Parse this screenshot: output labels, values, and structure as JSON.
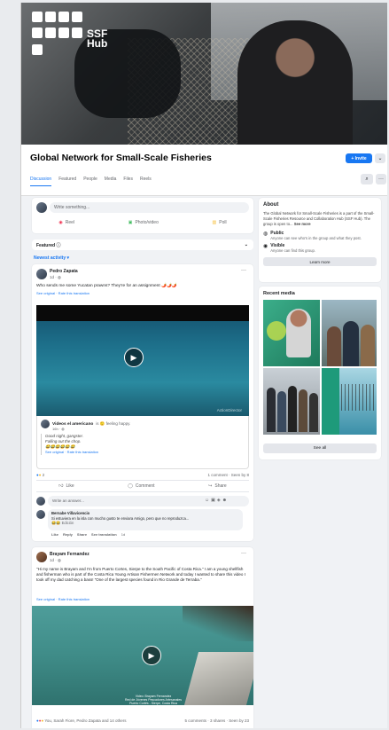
{
  "cover": {
    "logo_text_1": "SSF",
    "logo_text_2": "Hub"
  },
  "group": {
    "title": "Global Network for Small-Scale Fisheries",
    "invite_label": "+ Invite",
    "more_label": "⌄"
  },
  "tabs": [
    "Discussion",
    "Featured",
    "People",
    "Media",
    "Files",
    "Reels"
  ],
  "composer": {
    "placeholder": "Write something...",
    "live": "Reel",
    "photo": "Photo/video",
    "poll": "Poll"
  },
  "feed": {
    "sort_label": "Featured",
    "newest": "Newest activity"
  },
  "about": {
    "heading": "About",
    "text": "The Global Network for Small-Scale Fisheries is a part of the Small-Scale Fisheries Resource and Collaboration Hub (SSF Hub). The group is open to...",
    "see_more": "See more",
    "public_title": "Public",
    "public_desc": "Anyone can see who's in the group and what they post.",
    "visible_title": "Visible",
    "visible_desc": "Anyone can find this group.",
    "learn_more": "Learn more"
  },
  "recent_media": {
    "heading": "Recent media",
    "see_all": "See all"
  },
  "post1": {
    "author": "Pedro Zapata",
    "meta": "1d · ◍",
    "text": "Who sends me some Yucatan prawns? They're for an assignment 🌶️🌶️🌶️",
    "translate": "See original · Rate this translation",
    "shared_author": "Videos el americano",
    "shared_feeling": "is 🙂 feeling happy.",
    "shared_meta": "16h · ◍",
    "shared_text_1": "Good night, gangster.",
    "shared_text_2": "Falling out the chop.",
    "shared_emoji": "😂😂😂😂😂😂",
    "shared_translate": "See original · Rate this translation",
    "watermark": "ActionDirector",
    "reactions": "2",
    "counts": "1 comment · Seen by 8",
    "like": "Like",
    "comment": "Comment",
    "share": "Share",
    "comment_placeholder": "Write an answer...",
    "commenter": "Bernabe Villavicencio",
    "comment_text": "Si estuviera en la isla con mucho gusto te enviara Amigo, pero que no reproduzca...",
    "comment_emoji": "😂😂",
    "comment_edit": "Edición",
    "comment_actions": [
      "Like",
      "Reply",
      "Share",
      "See translation",
      "1d"
    ]
  },
  "post2": {
    "author": "Brayam Fernandez",
    "meta": "1d · ◍",
    "text": "\"Hi my name is Brayam and I'm from Puerto Cortes, Sierpe to the South Pacific of Costa Rica.\" I am a young shellfish and fisherman who is part of the Costa Rica Young Artisan Fishermen Network and today I wanted to share this video I took off my dad catching a bass! \"One of the largest species found in Rio Grande de Terraba.\"",
    "translate": "See original · Rate this translation",
    "caption_1": "Video: Brayam Fernandez",
    "caption_2": "Red de Jóvenes Pescadores Artesanales",
    "caption_3": "Puerto Cortés - Sierpe, Costa Rica",
    "reactions": "You, Sarah Fiore, Pedro Zapata and 14 others",
    "counts": "5 comments · 3 shares · Seen by 23"
  },
  "colors": {
    "accent": "#1877f2",
    "bg": "#f0f2f5"
  }
}
